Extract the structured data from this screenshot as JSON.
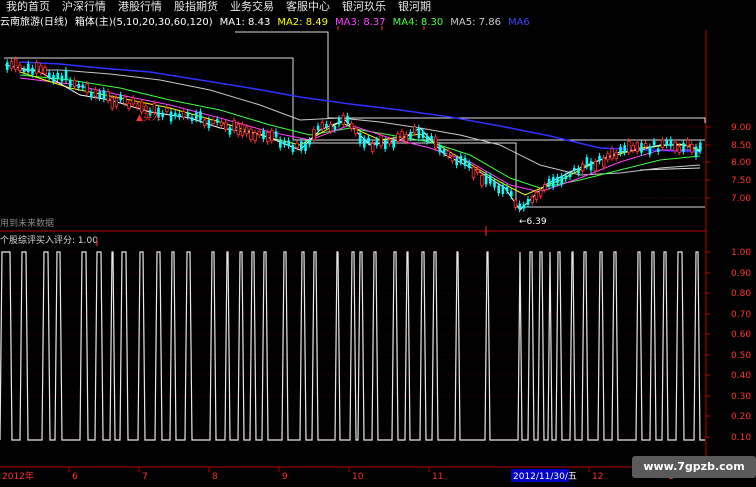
{
  "menubar": {
    "items": [
      "我的首页",
      "沪深行情",
      "港股行情",
      "股指期货",
      "业务交易",
      "客服中心",
      "银河玖乐",
      "银河期"
    ]
  },
  "header": {
    "stock": "云南旅游(日线)",
    "indicator": "箱体(主)(5,10,20,30,60,120)",
    "ma1": "MA1: 8.43",
    "ma2": "MA2: 8.49",
    "ma3": "MA3: 8.37",
    "ma4": "MA4: 8.30",
    "ma5": "MA5: 7.86",
    "ma6": "MA6"
  },
  "annotations": {
    "buy": "▲买入",
    "low": "←6.39",
    "future": "用到未来数据"
  },
  "lower": {
    "title": "个股综评",
    "score": "买入评分: 1.00"
  },
  "axis_right_upper": [
    "9.00",
    "8.50",
    "8.00",
    "7.50",
    "7.00"
  ],
  "axis_right_lower": [
    "1.00",
    "0.90",
    "0.80",
    "0.70",
    "0.60",
    "0.50",
    "0.40",
    "0.30",
    "0.20",
    "0.10"
  ],
  "date_axis": {
    "left_label": "2012年",
    "labels": [
      "6",
      "7",
      "8",
      "9",
      "10",
      "11",
      "12",
      "1"
    ],
    "highlight": "2012/11/30/五"
  },
  "watermark": "www.7gpzb.com",
  "colors": {
    "ma1": "#ffffff",
    "ma2": "#ffff00",
    "ma3": "#ff40ff",
    "ma4": "#40ff40",
    "ma5": "#cccccc",
    "ma6": "#3030ff",
    "up": "#ff3030",
    "down": "#00ffff",
    "grid": "#800000",
    "axis": "#c00000"
  }
}
